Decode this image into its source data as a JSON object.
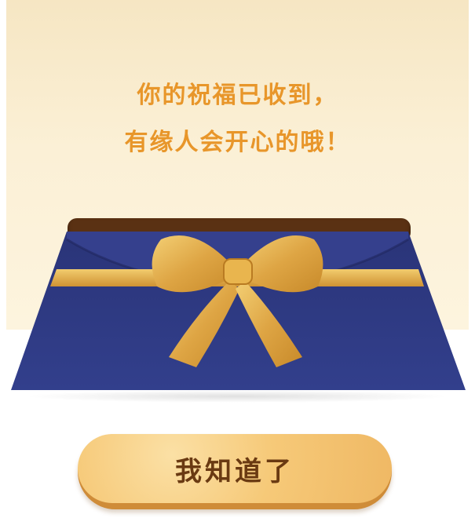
{
  "message": {
    "line1": "你的祝福已收到，",
    "line2": "有缘人会开心的哦！"
  },
  "dialog": {
    "confirm_label": "我知道了"
  },
  "colors": {
    "card_background": "#fbf0d6",
    "message_text": "#e8962a",
    "envelope_blue": "#2e3a83",
    "ribbon_gold": "#e6b252",
    "button_face": "#f6c978",
    "button_text": "#6a3a12"
  },
  "icons": {
    "envelope": "gift-envelope-icon",
    "bow": "ribbon-bow-icon"
  }
}
